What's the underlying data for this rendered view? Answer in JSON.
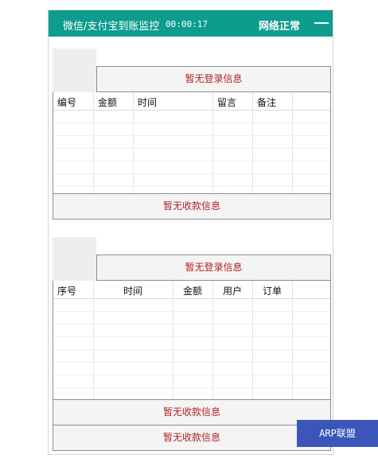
{
  "titlebar": {
    "title": "微信/支付宝到账监控",
    "timer": "00:00:17",
    "network_status": "网络正常"
  },
  "panel1": {
    "login_info": "暂无登录信息",
    "columns": [
      "编号",
      "金额",
      "时间",
      "留言",
      "备注"
    ],
    "footer": "暂无收款信息"
  },
  "panel2": {
    "login_info": "暂无登录信息",
    "columns": [
      "序号",
      "时间",
      "金额",
      "用户",
      "订单"
    ],
    "footer1": "暂无收款信息",
    "footer2": "暂无收款信息"
  },
  "watermark": "ARP联盟 arpun.com",
  "colors": {
    "titlebar_bg": "#0d9c8e",
    "accent_text": "#b22222",
    "watermark_bg": "#3b56b8"
  }
}
